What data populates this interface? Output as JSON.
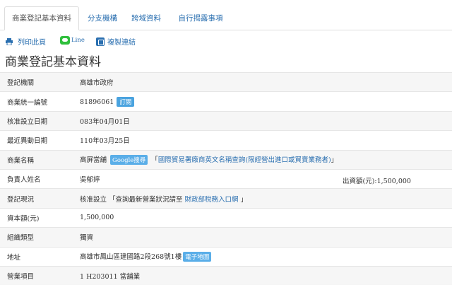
{
  "tabs": [
    {
      "label": "商業登記基本資料"
    },
    {
      "label": "分支機構"
    },
    {
      "label": "跨域資料"
    },
    {
      "label": "自行揭露事項"
    }
  ],
  "toolbar": {
    "print": "列印此頁",
    "line": "Line",
    "copy": "複製連結"
  },
  "page_title": "商業登記基本資料",
  "rows": {
    "authority": {
      "label": "登記機關",
      "value": "高雄市政府"
    },
    "uniform_no": {
      "label": "商業統一編號",
      "value": "81896061",
      "badge": "訂閱"
    },
    "approved_date": {
      "label": "核准設立日期",
      "value": "083年04月01日"
    },
    "changed_date": {
      "label": "最近異動日期",
      "value": "110年03月25日"
    },
    "name": {
      "label": "商業名稱",
      "value": "高屏當舖",
      "google": "Google搜尋",
      "pre": "「",
      "link": "國際貿易署廠商英文名稱查詢(限經營出進口或買賣業務者)",
      "post": "」"
    },
    "owner": {
      "label": "負責人姓名",
      "value": "吳郁婷",
      "capital": "出資額(元):1,500,000"
    },
    "status": {
      "label": "登記現況",
      "pre": "核准設立 「查詢最新營業狀況請至 ",
      "link": "財政部稅務入口網",
      "post": " 」"
    },
    "capital": {
      "label": "資本額(元)",
      "value": "1,500,000"
    },
    "org_type": {
      "label": "組織類型",
      "value": "獨資"
    },
    "address": {
      "label": "地址",
      "value": "高雄市鳳山區建國路2段268號1樓",
      "map": "電子地圖"
    },
    "business": {
      "label": "營業項目",
      "value": "1 H203011 當舖業"
    }
  }
}
